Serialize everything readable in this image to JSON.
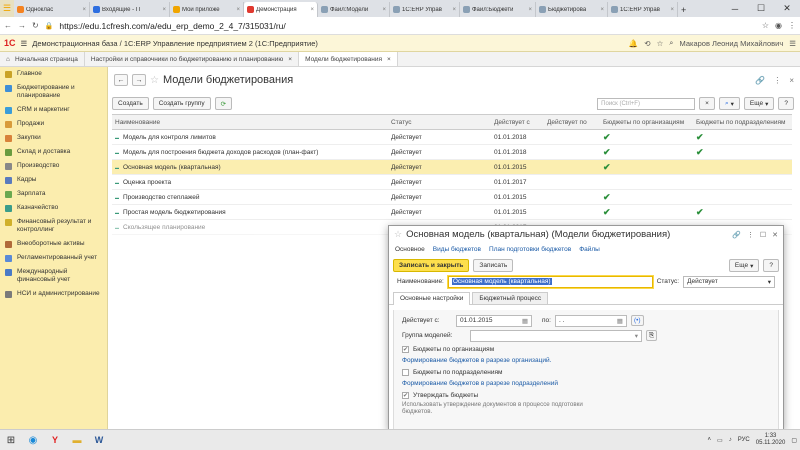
{
  "browser": {
    "tabs": [
      {
        "label": "Одноклас",
        "color": "#f58220",
        "active": false
      },
      {
        "label": "Входящие - П",
        "color": "#2d6ee0",
        "active": false
      },
      {
        "label": "Мои приложе",
        "color": "#f0a500",
        "active": false
      },
      {
        "label": "Демонстрация",
        "color": "#e0392f",
        "active": true
      },
      {
        "label": "Файл:Модели",
        "color": "#8aa0b5",
        "active": false
      },
      {
        "label": "1С:ERP Управ",
        "color": "#8aa0b5",
        "active": false
      },
      {
        "label": "Файл:Бюджети",
        "color": "#8aa0b5",
        "active": false
      },
      {
        "label": "Бюджетирова",
        "color": "#8aa0b5",
        "active": false
      },
      {
        "label": "1С:ERP Управ",
        "color": "#8aa0b5",
        "active": false
      }
    ],
    "url": "https://edu.1cfresh.com/a/edu_erp_demo_2_4_7/315031/ru/",
    "tab_close": "×",
    "new_tab": "+"
  },
  "app": {
    "title": "Демонстрационная база / 1С:ERP Управление предприятием 2  (1С:Предприятие)",
    "user": "Макаров Леонид Михайлович",
    "section_tabs": [
      "Начальная страница",
      "Настройки и справочники по бюджетированию и планированию",
      "Модели бюджетирования"
    ]
  },
  "sidebar": {
    "items": [
      {
        "label": "Главное",
        "color": "#c9a227"
      },
      {
        "label": "Бюджетирование и планирование",
        "color": "#3f8fd6"
      },
      {
        "label": "CRM и маркетинг",
        "color": "#3a9dd8"
      },
      {
        "label": "Продажи",
        "color": "#d89b3a"
      },
      {
        "label": "Закупки",
        "color": "#d8823a"
      },
      {
        "label": "Склад и доставка",
        "color": "#6a9b3f"
      },
      {
        "label": "Производство",
        "color": "#888888"
      },
      {
        "label": "Кадры",
        "color": "#5a7bbd"
      },
      {
        "label": "Зарплата",
        "color": "#6aa84f"
      },
      {
        "label": "Казначейство",
        "color": "#3a9d8a"
      },
      {
        "label": "Финансовый результат и контроллинг",
        "color": "#d0b02a"
      },
      {
        "label": "Внеоборотные активы",
        "color": "#b06a3a"
      },
      {
        "label": "Регламентированный учет",
        "color": "#5a8ad6"
      },
      {
        "label": "Международный финансовый учет",
        "color": "#4a7ac6"
      },
      {
        "label": "НСИ и администрирование",
        "color": "#7a7a7a"
      }
    ]
  },
  "main": {
    "title": "Модели бюджетирования",
    "create_label": "Создать",
    "create_group_label": "Создать группу",
    "search_placeholder": "Поиск (Ctrl+F)",
    "more_label": "Еще",
    "help_label": "?",
    "columns": [
      "Наименование",
      "Статус",
      "Действует с",
      "Действует по",
      "Бюджеты по организациям",
      "Бюджеты по подразделениям"
    ],
    "rows": [
      {
        "name": "Модель для контроля лимитов",
        "status": "Действует",
        "from": "01.01.2018",
        "to": "",
        "org": true,
        "dep": true,
        "selected": false
      },
      {
        "name": "Модель для построения бюджета доходов расходов (план-факт)",
        "status": "Действует",
        "from": "01.01.2018",
        "to": "",
        "org": true,
        "dep": true,
        "selected": false
      },
      {
        "name": "Основная модель (квартальная)",
        "status": "Действует",
        "from": "01.01.2015",
        "to": "",
        "org": true,
        "dep": false,
        "selected": true
      },
      {
        "name": "Оценка проекта",
        "status": "Действует",
        "from": "01.01.2017",
        "to": "",
        "org": false,
        "dep": false,
        "selected": false
      },
      {
        "name": "Производство степлажей",
        "status": "Действует",
        "from": "01.01.2015",
        "to": "",
        "org": true,
        "dep": false,
        "selected": false
      },
      {
        "name": "Простая модель бюджетирования",
        "status": "Действует",
        "from": "01.01.2015",
        "to": "",
        "org": true,
        "dep": true,
        "selected": false
      },
      {
        "name": "Скользящее планирование",
        "status": "",
        "from": "01.01.2017",
        "to": "",
        "org": false,
        "dep": false,
        "selected": false
      }
    ]
  },
  "dialog": {
    "title": "Основная модель (квартальная) (Модели бюджетирования)",
    "links": [
      "Основное",
      "Виды бюджетов",
      "План подготовки бюджетов",
      "Файлы"
    ],
    "save_close_label": "Записать и закрыть",
    "save_label": "Записать",
    "more_label": "Еще",
    "help_label": "?",
    "name_label": "Наименование:",
    "name_value": "Основная модель (квартальная)",
    "status_label": "Статус:",
    "status_value": "Действует",
    "inner_tabs": [
      "Основные настройки",
      "Бюджетный процесс"
    ],
    "valid_from_label": "Действует с:",
    "valid_from_value": "01.01.2015",
    "valid_to_label": "по:",
    "valid_to_value": " .  . ",
    "group_label": "Группа моделей:",
    "group_value": "",
    "org_budgets_label": "Бюджеты по организациям",
    "org_budgets_checked": true,
    "org_budgets_link": "Формирование бюджетов в разрезе организаций.",
    "dep_budgets_label": "Бюджеты по подразделениям",
    "dep_budgets_checked": false,
    "dep_budgets_link": "Формирование бюджетов в разрезе подразделений",
    "approve_label": "Утверждать бюджеты",
    "approve_checked": true,
    "approve_note": "Использовать утверждение документов в процессе подготовки бюджетов."
  },
  "taskbar": {
    "lang": "РУС",
    "time": "1:33",
    "date": "05.11.2020"
  }
}
